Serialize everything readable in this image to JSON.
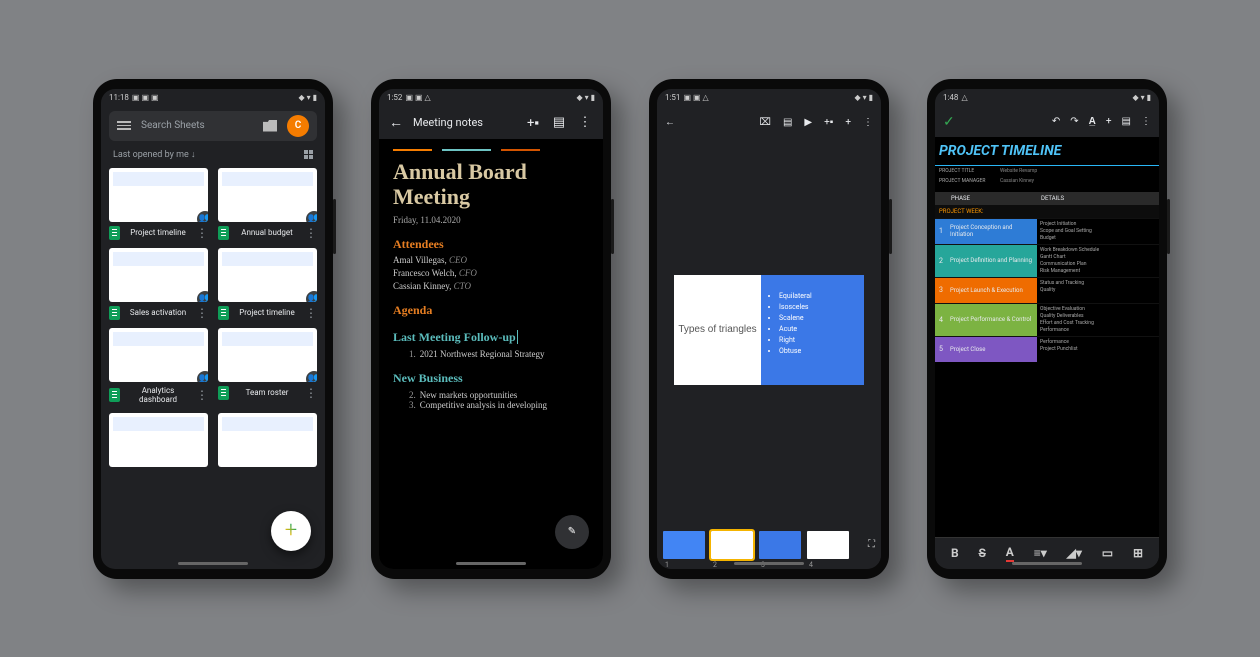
{
  "phone1": {
    "status_time": "11:18",
    "search_placeholder": "Search Sheets",
    "avatar_letter": "C",
    "sort_label": "Last opened by me ↓",
    "files": [
      {
        "name": "Project timeline"
      },
      {
        "name": "Annual budget"
      },
      {
        "name": "Sales activation"
      },
      {
        "name": "Project timeline"
      },
      {
        "name": "Analytics dashboard"
      },
      {
        "name": "Team roster"
      }
    ]
  },
  "phone2": {
    "status_time": "1:52",
    "title": "Meeting notes",
    "heading": "Annual Board Meeting",
    "date": "Friday, 11.04.2020",
    "attendees_h": "Attendees",
    "attendees": [
      {
        "name": "Amal Villegas",
        "role": "CEO"
      },
      {
        "name": "Francesco Welch",
        "role": "CFO"
      },
      {
        "name": "Cassian Kinney",
        "role": "CTO"
      }
    ],
    "agenda_h": "Agenda",
    "lastmeeting_h": "Last Meeting Follow-up",
    "agenda_items": [
      "2021 Northwest Regional Strategy"
    ],
    "newbiz_h": "New Business",
    "newbiz_items": [
      "New markets opportunities",
      "Competitive analysis in developing"
    ]
  },
  "phone3": {
    "status_time": "1:51",
    "slide_title": "Types of triangles",
    "bullets": [
      "Equilateral",
      "Isosceles",
      "Scalene",
      "Acute",
      "Right",
      "Obtuse"
    ],
    "filmstrip": [
      "1",
      "2",
      "3",
      "4"
    ]
  },
  "phone4": {
    "status_time": "1:48",
    "title": "PROJECT TIMELINE",
    "meta": [
      {
        "k": "PROJECT TITLE",
        "v": "Website Revamp"
      },
      {
        "k": "PROJECT MANAGER",
        "v": "Cassian Kinney"
      }
    ],
    "col_phase": "PHASE",
    "col_details": "DETAILS",
    "week_label": "PROJECT WEEK:",
    "phases": [
      {
        "n": "1",
        "name": "Project Conception and Initiation",
        "det": "Project Initiation · Scope and Goal Setting · Budget"
      },
      {
        "n": "2",
        "name": "Project Definition and Planning",
        "det": "Work Breakdown Schedule · Gantt Chart · Communication Plan · Risk Management"
      },
      {
        "n": "3",
        "name": "Project Launch & Execution",
        "det": "Status and Tracking · Quality"
      },
      {
        "n": "4",
        "name": "Project Performance & Control",
        "det": "Objective Evaluation · Quality Deliverables · Effort and Cost Tracking · Performance"
      },
      {
        "n": "5",
        "name": "Project Close",
        "det": "Performance · Project Punchlist"
      }
    ]
  }
}
